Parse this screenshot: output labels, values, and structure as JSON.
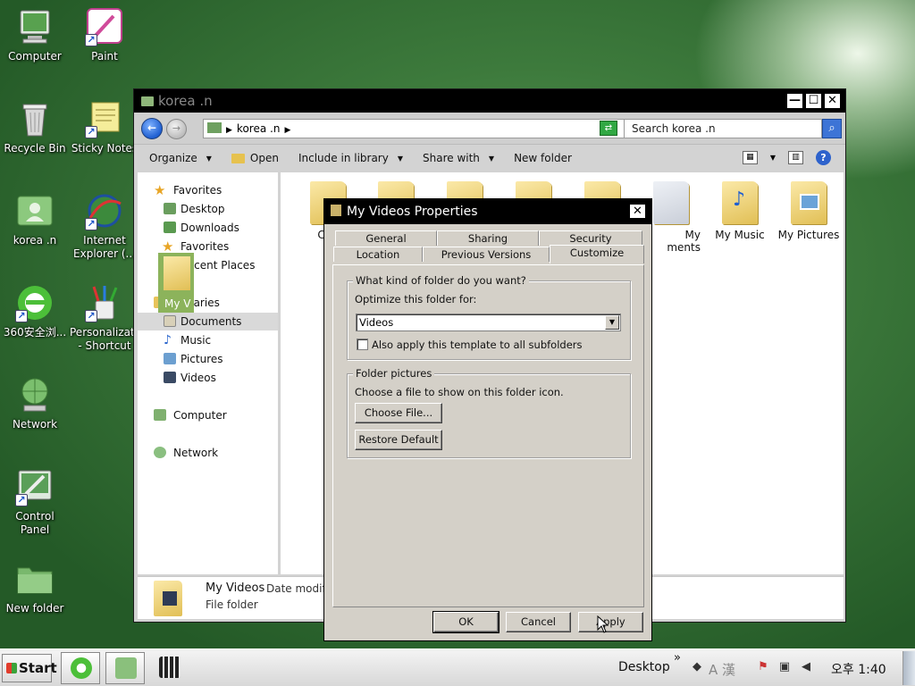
{
  "desktop_icons": [
    {
      "label": "Computer"
    },
    {
      "label": "Paint"
    },
    {
      "label": "Recycle Bin"
    },
    {
      "label": "Sticky Notes"
    },
    {
      "label": "korea .n"
    },
    {
      "label": "Internet Explorer (..."
    },
    {
      "label": "360安全浏..."
    },
    {
      "label": "Personalizat... - Shortcut"
    },
    {
      "label": "Network"
    },
    {
      "label": "Control Panel"
    },
    {
      "label": "New folder"
    }
  ],
  "explorer": {
    "title": "korea .n",
    "window_buttons": {
      "minimize": "—",
      "maximize": "☐",
      "close": "✕"
    },
    "address": "korea .n",
    "search_placeholder": "Search korea .n",
    "toolbar": [
      "Organize",
      "Open",
      "Include in library",
      "Share with",
      "New folder"
    ],
    "nav": {
      "favorites_header": "Favorites",
      "favorites": [
        "Desktop",
        "Downloads",
        "Favorites",
        "Recent Places"
      ],
      "libraries_header": "Libraries",
      "libraries": [
        "Documents",
        "Music",
        "Pictures",
        "Videos"
      ],
      "computer": "Computer",
      "network": "Network"
    },
    "folders": [
      {
        "label": "Con"
      },
      {
        "label": ""
      },
      {
        "label": ""
      },
      {
        "label": ""
      },
      {
        "label": ""
      },
      {
        "label": "My\nments"
      },
      {
        "label": "My Music"
      },
      {
        "label": "My Pictures"
      }
    ],
    "selected_folder_label": "My V",
    "details": {
      "name": "My Videos",
      "meta": "Date modifi",
      "type": "File folder"
    }
  },
  "dialog": {
    "title": "My Videos Properties",
    "close": "✕",
    "tabs_row1": [
      "General",
      "Sharing",
      "Security"
    ],
    "tabs_row2": [
      "Location",
      "Previous Versions",
      "Customize"
    ],
    "active_tab": "Customize",
    "group1": {
      "legend": "What kind of folder do you want?",
      "optimize_label": "Optimize this folder for:",
      "optimize_value": "Videos",
      "subfolders_label": "Also apply this template to all subfolders",
      "subfolders_checked": false
    },
    "group2": {
      "legend": "Folder pictures",
      "choose_label": "Choose a file to show on this folder icon.",
      "choose_button": "Choose File...",
      "restore_button": "Restore Default"
    },
    "buttons": {
      "ok": "OK",
      "cancel": "Cancel",
      "apply": "Apply"
    }
  },
  "taskbar": {
    "start": "Start",
    "desktop_label": "Desktop",
    "chevron": "»",
    "ime": "A 漢",
    "clock": "오후 1:40"
  }
}
